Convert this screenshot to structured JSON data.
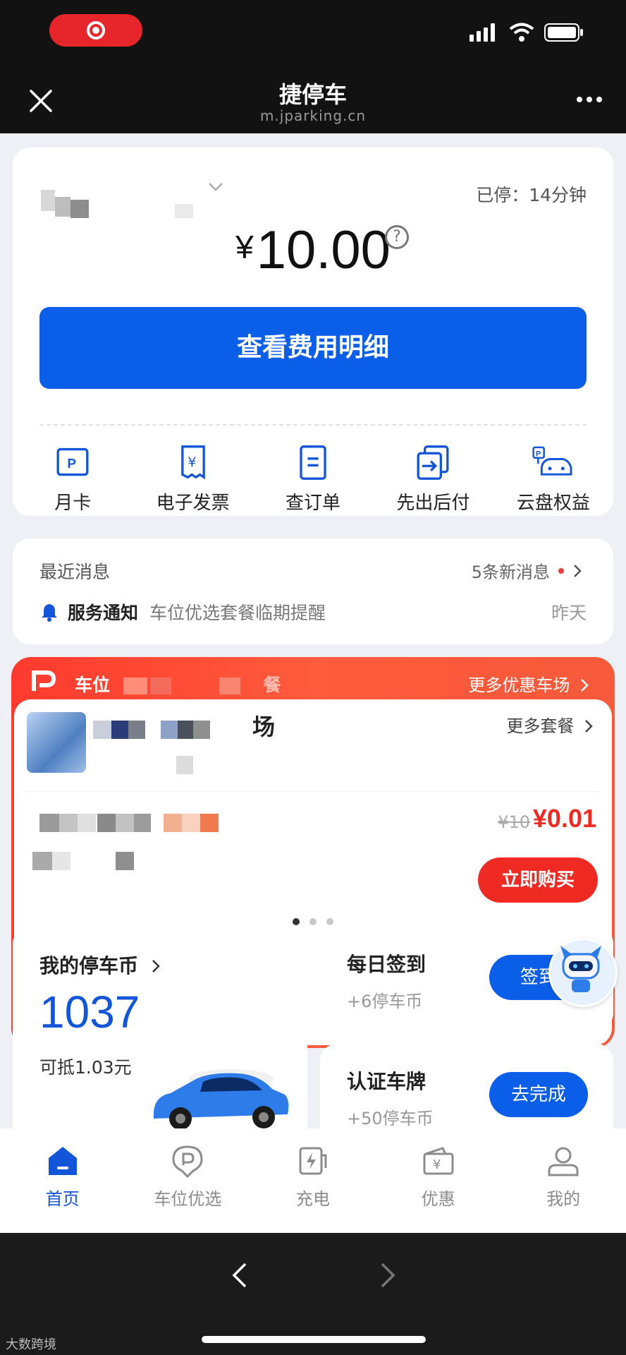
{
  "browser": {
    "title": "捷停车",
    "domain": "m.jparking.cn"
  },
  "parking": {
    "duration": "已停：14分钟",
    "currency": "¥",
    "amount": "10.00",
    "detail_button": "查看费用明细"
  },
  "quick_actions": [
    {
      "label": "月卡",
      "icon": "monthly-card-icon"
    },
    {
      "label": "电子发票",
      "icon": "invoice-icon"
    },
    {
      "label": "查订单",
      "icon": "order-icon"
    },
    {
      "label": "先出后付",
      "icon": "exit-pay-later-icon"
    },
    {
      "label": "云盘权益",
      "icon": "cloud-benefit-icon"
    }
  ],
  "messages": {
    "header": "最近消息",
    "new_count": "5条新消息",
    "type": "服务通知",
    "text": "车位优选套餐临期提醒",
    "time": "昨天"
  },
  "promo": {
    "title": "车位",
    "title_end": "餐",
    "more": "更多优惠车场",
    "lot_name_end": "场",
    "more_packages": "更多套餐",
    "old_price": "¥10",
    "new_price": "¥0.01",
    "buy_button": "立即购买"
  },
  "coins": {
    "title": "我的停车币",
    "value": "1037",
    "worth": "可抵1.03元"
  },
  "tasks": [
    {
      "title": "每日签到",
      "reward": "+6停车币",
      "button": "签到"
    },
    {
      "title": "认证车牌",
      "reward": "+50停车币",
      "button": "去完成"
    }
  ],
  "tabs": [
    {
      "label": "首页",
      "icon": "home-icon",
      "active": true
    },
    {
      "label": "车位优选",
      "icon": "parking-select-icon",
      "active": false
    },
    {
      "label": "充电",
      "icon": "charging-icon",
      "active": false
    },
    {
      "label": "优惠",
      "icon": "coupon-icon",
      "active": false
    },
    {
      "label": "我的",
      "icon": "profile-icon",
      "active": false
    }
  ],
  "watermark": "大数跨境",
  "colors": {
    "primary": "#0b5ee8",
    "promo": "#ff3a2e",
    "price_red": "#ee2a22"
  }
}
